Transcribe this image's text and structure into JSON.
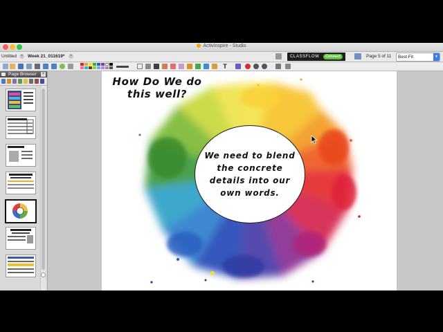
{
  "window": {
    "app_title": "ActivInspire - Studio"
  },
  "tabs": [
    {
      "label": "Untitled"
    },
    {
      "label": "Week 21_011619*"
    }
  ],
  "classflow": {
    "label": "CLASSFLOW",
    "connect_label": "Connect"
  },
  "page_indicator": "Page 5 of 11",
  "zoom": {
    "value": "Best Fit"
  },
  "page_browser": {
    "title": "Page Browser",
    "thumbnails": [
      {
        "name": "page-1"
      },
      {
        "name": "page-2"
      },
      {
        "name": "page-3"
      },
      {
        "name": "page-4"
      },
      {
        "name": "page-5",
        "active": true
      },
      {
        "name": "page-6"
      },
      {
        "name": "page-7"
      }
    ]
  },
  "slide": {
    "heading_line1": "How Do We do",
    "heading_line2": "this well?",
    "circle_line1": "We need to blend",
    "circle_line2": "the concrete",
    "circle_line3": "details into our",
    "circle_line4": "own words."
  },
  "colors": {
    "classflow_bg": "#1d1d1d",
    "connect_green": "#5cc13a",
    "zoom_accent": "#3b7cf0"
  }
}
